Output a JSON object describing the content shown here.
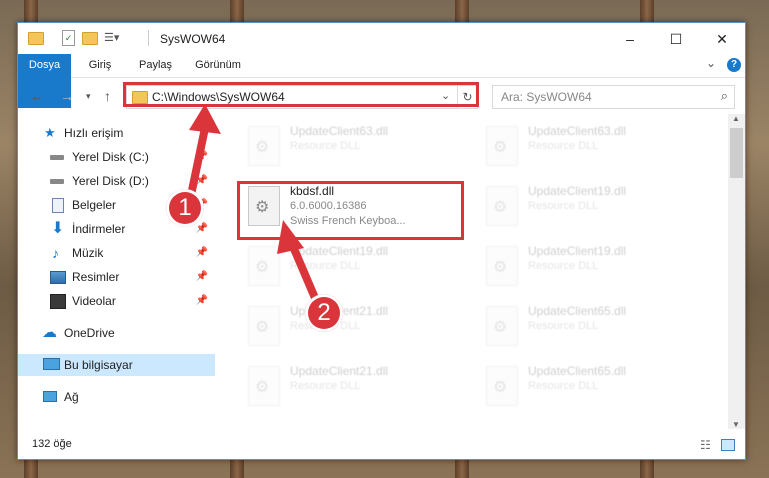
{
  "window": {
    "title": "SysWOW64",
    "minimize": "–",
    "maximize": "☐",
    "close": "✕"
  },
  "ribbon": {
    "tabs": [
      "Dosya",
      "Giriş",
      "Paylaş",
      "Görünüm"
    ],
    "collapse": "⌄",
    "help": "?"
  },
  "address": {
    "path": "C:\\Windows\\SysWOW64",
    "search_placeholder": "Ara: SysWOW64"
  },
  "nav": {
    "quick_access": "Hızlı erişim",
    "items": [
      {
        "label": "Yerel Disk (C:)",
        "icon": "drive-icon",
        "pinned": true
      },
      {
        "label": "Yerel Disk (D:)",
        "icon": "drive-icon",
        "pinned": true
      },
      {
        "label": "Belgeler",
        "icon": "documents-icon",
        "pinned": true
      },
      {
        "label": "İndirmeler",
        "icon": "downloads-icon",
        "pinned": true
      },
      {
        "label": "Müzik",
        "icon": "music-icon",
        "pinned": true
      },
      {
        "label": "Resimler",
        "icon": "pictures-icon",
        "pinned": true
      },
      {
        "label": "Videolar",
        "icon": "videos-icon",
        "pinned": true
      }
    ],
    "onedrive": "OneDrive",
    "this_pc": "Bu bilgisayar",
    "network": "Ağ"
  },
  "files": [
    {
      "name": "UpdateClient63.dll",
      "desc": "Resource DLL"
    },
    {
      "name": "UpdateClient63.dll",
      "desc": "Resource DLL"
    },
    {
      "name": "kbdsf.dll",
      "version": "6.0.6000.16386",
      "desc": "Swiss French Keyboa..."
    },
    {
      "name": "UpdateClient19.dll",
      "desc": "Resource DLL"
    },
    {
      "name": "UpdateClient19.dll",
      "desc": "Resource DLL"
    },
    {
      "name": "UpdateClient19.dll",
      "desc": "Resource DLL"
    },
    {
      "name": "UpdateClient21.dll",
      "desc": "Resource DLL"
    },
    {
      "name": "UpdateClient65.dll",
      "desc": "Resource DLL"
    },
    {
      "name": "UpdateClient21.dll",
      "desc": "Resource DLL"
    },
    {
      "name": "UpdateClient65.dll",
      "desc": "Resource DLL"
    }
  ],
  "status": {
    "count": "132 öğe"
  },
  "annotations": [
    "1",
    "2"
  ],
  "colors": {
    "accent": "#1979ca",
    "highlight": "#d9353b",
    "selected": "#cce8ff"
  }
}
